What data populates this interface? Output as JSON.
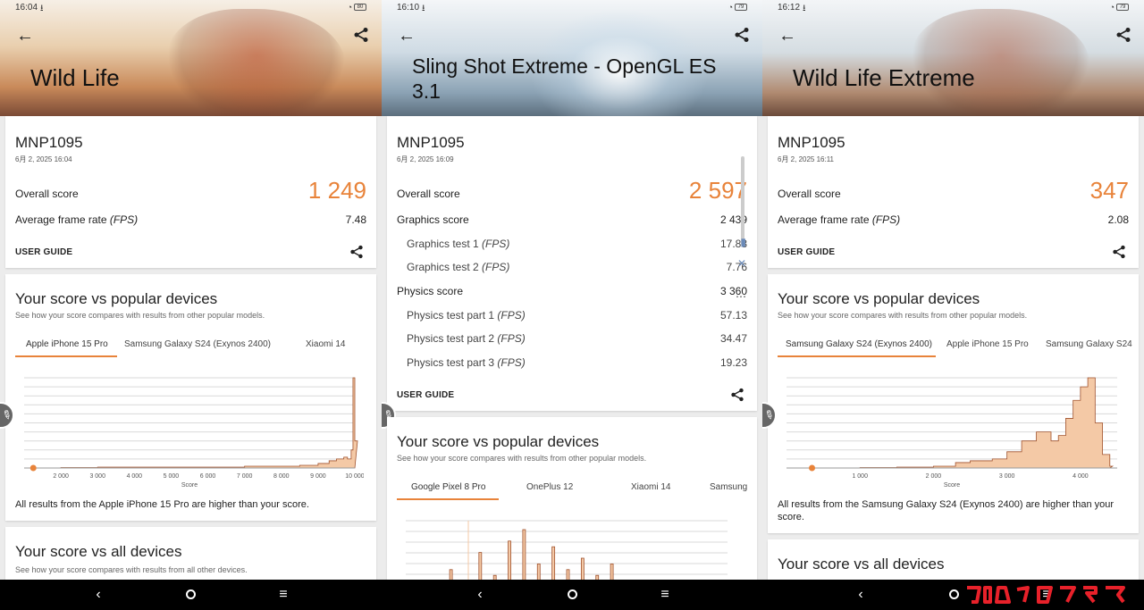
{
  "colors": {
    "accent": "#e8833a",
    "bar_fill": "#f4c9a6",
    "bar_stroke": "#a0522d",
    "watermark": "#e8212a"
  },
  "icons": {
    "back": "arrow-left-icon",
    "share": "share-icon",
    "home": "circle-icon",
    "menu": "hamburger-icon"
  },
  "panels": [
    {
      "status": {
        "time": "16:04",
        "battery": "80"
      },
      "title": "Wild Life",
      "device": "MNP1095",
      "date": "6月 2, 2025 16:04",
      "overall_label": "Overall score",
      "overall_value": "1 249",
      "fps_label": "Average frame rate",
      "fps_unit": "(FPS)",
      "fps_value": "7.48",
      "user_guide": "USER GUIDE",
      "popular_title": "Your score vs popular devices",
      "popular_desc": "See how your score compares with results from other popular models.",
      "tabs": [
        "Apple iPhone 15 Pro",
        "Samsung Galaxy S24 (Exynos 2400)",
        "Xiaomi 14"
      ],
      "result_text": "All results from the Apple iPhone 15 Pro are higher than your score.",
      "all_title": "Your score vs all devices",
      "all_desc": "See how your score compares with results from all other devices."
    },
    {
      "status": {
        "time": "16:10",
        "battery": "79"
      },
      "title": "Sling Shot Extreme - OpenGL ES 3.1",
      "device": "MNP1095",
      "date": "6月 2, 2025 16:09",
      "overall_label": "Overall score",
      "overall_value": "2 597",
      "graphics_label": "Graphics score",
      "graphics_value": "2 439",
      "gt1_label": "Graphics test 1",
      "gt1_value": "17.83",
      "gt2_label": "Graphics test 2",
      "gt2_value": "7.76",
      "physics_label": "Physics score",
      "physics_value": "3 360",
      "pt1_label": "Physics test part 1",
      "pt1_value": "57.13",
      "pt2_label": "Physics test part 2",
      "pt2_value": "34.47",
      "pt3_label": "Physics test part 3",
      "pt3_value": "19.23",
      "fps_unit": "(FPS)",
      "user_guide": "USER GUIDE",
      "popular_title": "Your score vs popular devices",
      "popular_desc": "See how your score compares with results from other popular models.",
      "tabs": [
        "Google Pixel 8 Pro",
        "OnePlus 12",
        "Xiaomi 14",
        "Samsung"
      ]
    },
    {
      "status": {
        "time": "16:12",
        "battery": "79"
      },
      "title": "Wild Life Extreme",
      "device": "MNP1095",
      "date": "6月 2, 2025 16:11",
      "overall_label": "Overall score",
      "overall_value": "347",
      "fps_label": "Average frame rate",
      "fps_unit": "(FPS)",
      "fps_value": "2.08",
      "user_guide": "USER GUIDE",
      "popular_title": "Your score vs popular devices",
      "popular_desc": "See how your score compares with results from other popular models.",
      "tabs": [
        "Samsung Galaxy S24 (Exynos 2400)",
        "Apple iPhone 15 Pro",
        "Samsung Galaxy S24"
      ],
      "result_text": "All results from the Samsung Galaxy S24 (Exynos 2400) are higher than your score.",
      "all_title": "Your score vs all devices"
    }
  ],
  "chart_data": [
    {
      "type": "area",
      "xlabel": "Score",
      "x_ticks": [
        "2 000",
        "3 000",
        "4 000",
        "5 000",
        "6 000",
        "7 000",
        "8 000",
        "9 000",
        "10 000"
      ],
      "xlim": [
        1000,
        10000
      ],
      "your_score": 1249,
      "x": [
        1000,
        2000,
        3000,
        4000,
        5000,
        6000,
        7000,
        7500,
        8000,
        8500,
        9000,
        9300,
        9500,
        9700,
        9800,
        9900,
        9950,
        10000
      ],
      "y": [
        0,
        0.005,
        0.01,
        0.01,
        0.01,
        0.01,
        0.02,
        0.02,
        0.02,
        0.03,
        0.05,
        0.08,
        0.1,
        0.12,
        0.1,
        0.2,
        1.0,
        0.3
      ]
    },
    {
      "type": "area",
      "x": [
        2200,
        2300,
        2400,
        2500,
        2600,
        2700,
        2800,
        2900,
        3000,
        3100,
        3200,
        3300,
        3400
      ],
      "y": [
        0.1,
        0.3,
        0.1,
        0.6,
        0.2,
        0.8,
        1.0,
        0.4,
        0.7,
        0.3,
        0.5,
        0.2,
        0.4
      ]
    },
    {
      "type": "area",
      "xlabel": "Score",
      "x_ticks": [
        "1 000",
        "2 000",
        "3 000",
        "4 000"
      ],
      "xlim": [
        0,
        4500
      ],
      "your_score": 347,
      "x": [
        347,
        1000,
        1500,
        2000,
        2300,
        2500,
        2800,
        3000,
        3200,
        3400,
        3600,
        3700,
        3800,
        3900,
        4000,
        4100,
        4200,
        4300,
        4400
      ],
      "y": [
        0,
        0.005,
        0.01,
        0.02,
        0.06,
        0.08,
        0.1,
        0.18,
        0.3,
        0.4,
        0.3,
        0.36,
        0.55,
        0.75,
        0.9,
        1.0,
        0.5,
        0.15,
        0.02
      ]
    }
  ]
}
